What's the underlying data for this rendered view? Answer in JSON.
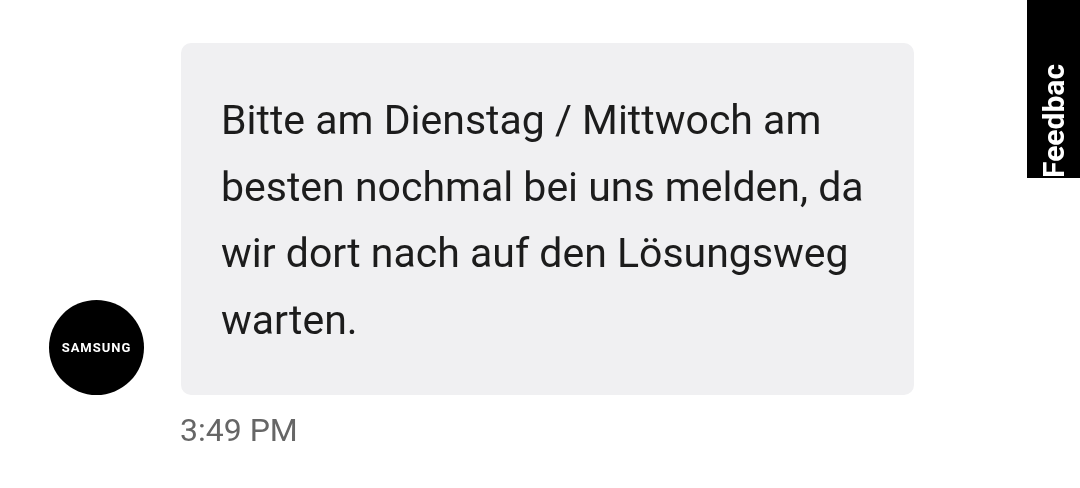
{
  "message": {
    "sender_avatar": "SAMSUNG",
    "text": "Bitte am Dienstag / Mittwoch am besten nochmal bei uns melden, da wir dort nach auf den Lösungsweg warten.",
    "time": "3:49 PM"
  },
  "feedback_tab": {
    "label": "Feedbac"
  }
}
